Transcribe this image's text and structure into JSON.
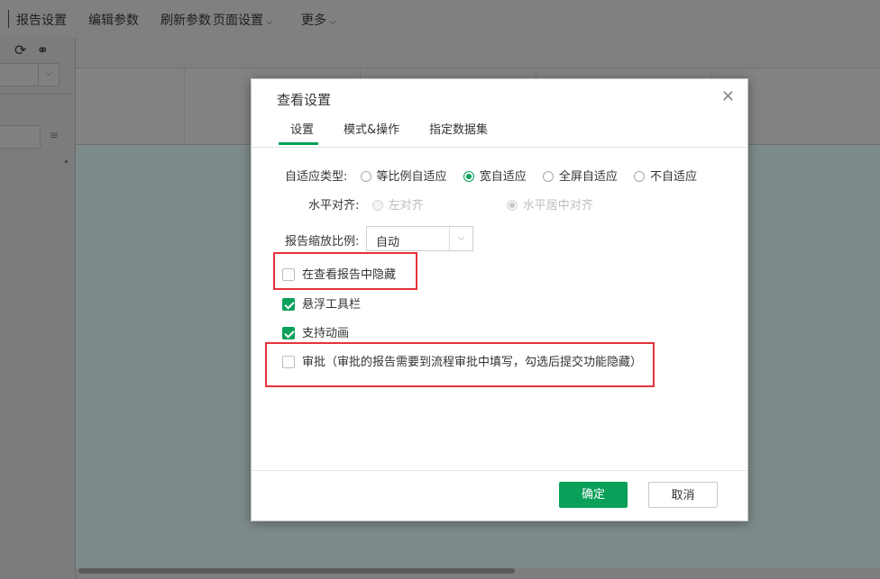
{
  "toolbar": {
    "items": [
      {
        "label": "报告设置",
        "dropdown": false
      },
      {
        "label": "编辑参数",
        "dropdown": false
      },
      {
        "label": "刷新参数",
        "dropdown": false
      },
      {
        "label": "页面设置",
        "dropdown": true
      },
      {
        "label": "更多",
        "dropdown": true
      }
    ]
  },
  "dialog": {
    "title": "查看设置",
    "tabs": [
      "设置",
      "模式&操作",
      "指定数据集"
    ],
    "active_tab": 0,
    "adaptive": {
      "label": "自适应类型:",
      "options": [
        "等比例自适应",
        "宽自适应",
        "全屏自适应",
        "不自适应"
      ],
      "selected": 1
    },
    "align": {
      "label": "水平对齐:",
      "options": [
        "左对齐",
        "水平居中对齐"
      ],
      "selected": 1,
      "disabled": true
    },
    "zoom": {
      "label": "报告缩放比例:",
      "value": "自动"
    },
    "checkboxes": [
      {
        "label": "在查看报告中隐藏",
        "checked": false,
        "highlighted": true
      },
      {
        "label": "悬浮工具栏",
        "checked": true,
        "highlighted": false
      },
      {
        "label": "支持动画",
        "checked": true,
        "highlighted": false
      },
      {
        "label": "审批（审批的报告需要到流程审批中填写，勾选后提交功能隐藏）",
        "checked": false,
        "highlighted": true
      }
    ],
    "ok_label": "确定",
    "cancel_label": "取消"
  },
  "colors": {
    "accent": "#0aa05a",
    "highlight": "#e5333b",
    "overlay": "#7f7f7f"
  }
}
